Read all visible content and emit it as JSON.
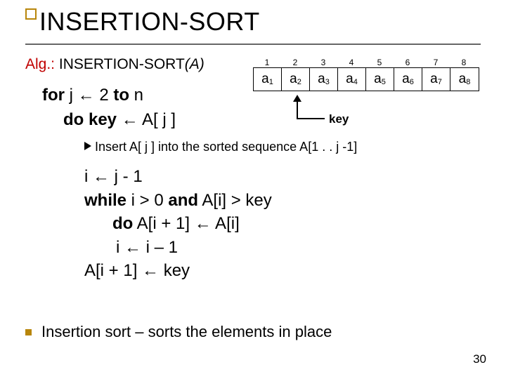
{
  "title": "INSERTION-SORT",
  "alg": {
    "prefix": "Alg.:",
    "name": "INSERTION-SORT",
    "arg": "(A)"
  },
  "code": {
    "line1_a": "for",
    "line1_b": " j ← 2 ",
    "line1_c": "to",
    "line1_d": " n",
    "line2_a": "do key",
    "line2_b": " ← A[ j ]"
  },
  "comment": "Insert A[ j ] into the sorted sequence A[1 . . j -1]",
  "block2": {
    "l1": "i ← j - 1",
    "l2_a": "while",
    "l2_b": " i > 0 ",
    "l2_c": "and",
    "l2_d": " A[i] > key",
    "l3_a": "do",
    "l3_b": " A[i + 1] ← A[i]",
    "l4": "i ← i – 1",
    "l5": "A[i + 1] ← key"
  },
  "footer": "Insertion sort – sorts the elements in place",
  "page": "30",
  "array": {
    "indices": [
      "1",
      "2",
      "3",
      "4",
      "5",
      "6",
      "7",
      "8"
    ],
    "cells": [
      "a1",
      "a2",
      "a3",
      "a4",
      "a5",
      "a6",
      "a7",
      "a8"
    ],
    "key_label": "key"
  }
}
